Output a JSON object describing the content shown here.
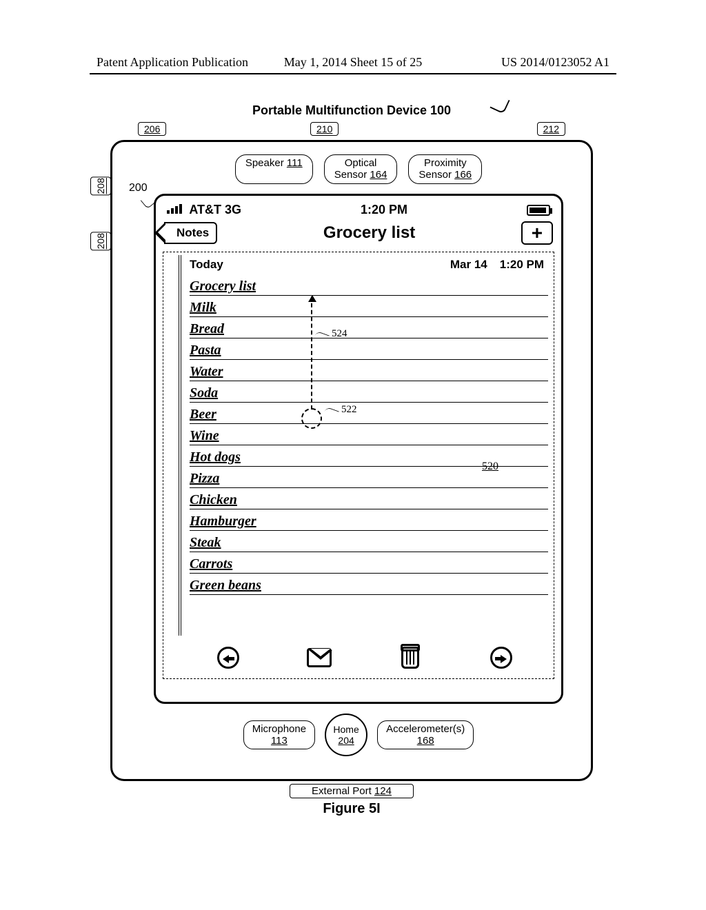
{
  "header": {
    "left": "Patent Application Publication",
    "center": "May 1, 2014  Sheet 15 of 25",
    "right": "US 2014/0123052 A1"
  },
  "device_title": "Portable Multifunction Device 100",
  "top_pills": {
    "p206": "206",
    "p210": "210",
    "p212": "212"
  },
  "side_tabs": {
    "t1": "208",
    "t2": "208"
  },
  "ref200": "200",
  "sensors": {
    "speaker": {
      "label": "Speaker",
      "num": "111"
    },
    "optical": {
      "label1": "Optical",
      "label2": "Sensor",
      "num": "164"
    },
    "proximity": {
      "label1": "Proximity",
      "label2": "Sensor",
      "num": "166"
    }
  },
  "status": {
    "carrier": "AT&T 3G",
    "time": "1:20 PM"
  },
  "nav": {
    "back": "Notes",
    "title": "Grocery list",
    "plus": "+"
  },
  "note": {
    "today": "Today",
    "date": "Mar 14",
    "time": "1:20 PM",
    "title": "Grocery list",
    "items": [
      "Milk",
      "Bread",
      "Pasta",
      "Water",
      "Soda",
      "Beer",
      "Wine",
      "Hot dogs",
      "Pizza",
      "Chicken",
      "Hamburger",
      "Steak",
      "Carrots",
      "Green beans"
    ]
  },
  "refs": {
    "r520": "520",
    "r522": "522",
    "r524": "524"
  },
  "bottom": {
    "mic": {
      "label": "Microphone",
      "num": "113"
    },
    "home": {
      "label": "Home",
      "num": "204"
    },
    "accel": {
      "label": "Accelerometer(s)",
      "num": "168"
    }
  },
  "ext_port": {
    "label": "External Port",
    "num": "124"
  },
  "figure": "Figure 5I"
}
